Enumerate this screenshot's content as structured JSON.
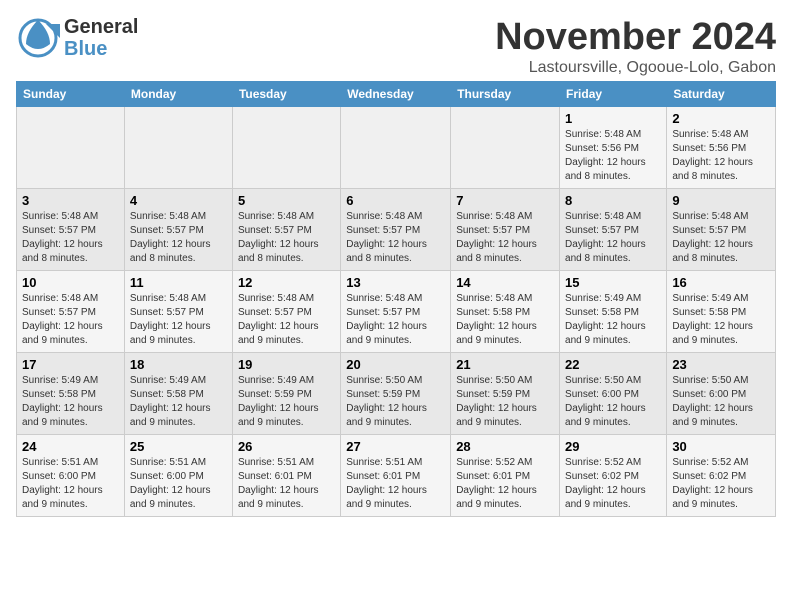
{
  "header": {
    "logo_line1": "General",
    "logo_line2": "Blue",
    "month": "November 2024",
    "location": "Lastoursville, Ogooue-Lolo, Gabon"
  },
  "columns": [
    "Sunday",
    "Monday",
    "Tuesday",
    "Wednesday",
    "Thursday",
    "Friday",
    "Saturday"
  ],
  "weeks": [
    [
      {
        "num": "",
        "detail": ""
      },
      {
        "num": "",
        "detail": ""
      },
      {
        "num": "",
        "detail": ""
      },
      {
        "num": "",
        "detail": ""
      },
      {
        "num": "",
        "detail": ""
      },
      {
        "num": "1",
        "detail": "Sunrise: 5:48 AM\nSunset: 5:56 PM\nDaylight: 12 hours and 8 minutes."
      },
      {
        "num": "2",
        "detail": "Sunrise: 5:48 AM\nSunset: 5:56 PM\nDaylight: 12 hours and 8 minutes."
      }
    ],
    [
      {
        "num": "3",
        "detail": "Sunrise: 5:48 AM\nSunset: 5:57 PM\nDaylight: 12 hours and 8 minutes."
      },
      {
        "num": "4",
        "detail": "Sunrise: 5:48 AM\nSunset: 5:57 PM\nDaylight: 12 hours and 8 minutes."
      },
      {
        "num": "5",
        "detail": "Sunrise: 5:48 AM\nSunset: 5:57 PM\nDaylight: 12 hours and 8 minutes."
      },
      {
        "num": "6",
        "detail": "Sunrise: 5:48 AM\nSunset: 5:57 PM\nDaylight: 12 hours and 8 minutes."
      },
      {
        "num": "7",
        "detail": "Sunrise: 5:48 AM\nSunset: 5:57 PM\nDaylight: 12 hours and 8 minutes."
      },
      {
        "num": "8",
        "detail": "Sunrise: 5:48 AM\nSunset: 5:57 PM\nDaylight: 12 hours and 8 minutes."
      },
      {
        "num": "9",
        "detail": "Sunrise: 5:48 AM\nSunset: 5:57 PM\nDaylight: 12 hours and 8 minutes."
      }
    ],
    [
      {
        "num": "10",
        "detail": "Sunrise: 5:48 AM\nSunset: 5:57 PM\nDaylight: 12 hours and 9 minutes."
      },
      {
        "num": "11",
        "detail": "Sunrise: 5:48 AM\nSunset: 5:57 PM\nDaylight: 12 hours and 9 minutes."
      },
      {
        "num": "12",
        "detail": "Sunrise: 5:48 AM\nSunset: 5:57 PM\nDaylight: 12 hours and 9 minutes."
      },
      {
        "num": "13",
        "detail": "Sunrise: 5:48 AM\nSunset: 5:57 PM\nDaylight: 12 hours and 9 minutes."
      },
      {
        "num": "14",
        "detail": "Sunrise: 5:48 AM\nSunset: 5:58 PM\nDaylight: 12 hours and 9 minutes."
      },
      {
        "num": "15",
        "detail": "Sunrise: 5:49 AM\nSunset: 5:58 PM\nDaylight: 12 hours and 9 minutes."
      },
      {
        "num": "16",
        "detail": "Sunrise: 5:49 AM\nSunset: 5:58 PM\nDaylight: 12 hours and 9 minutes."
      }
    ],
    [
      {
        "num": "17",
        "detail": "Sunrise: 5:49 AM\nSunset: 5:58 PM\nDaylight: 12 hours and 9 minutes."
      },
      {
        "num": "18",
        "detail": "Sunrise: 5:49 AM\nSunset: 5:58 PM\nDaylight: 12 hours and 9 minutes."
      },
      {
        "num": "19",
        "detail": "Sunrise: 5:49 AM\nSunset: 5:59 PM\nDaylight: 12 hours and 9 minutes."
      },
      {
        "num": "20",
        "detail": "Sunrise: 5:50 AM\nSunset: 5:59 PM\nDaylight: 12 hours and 9 minutes."
      },
      {
        "num": "21",
        "detail": "Sunrise: 5:50 AM\nSunset: 5:59 PM\nDaylight: 12 hours and 9 minutes."
      },
      {
        "num": "22",
        "detail": "Sunrise: 5:50 AM\nSunset: 6:00 PM\nDaylight: 12 hours and 9 minutes."
      },
      {
        "num": "23",
        "detail": "Sunrise: 5:50 AM\nSunset: 6:00 PM\nDaylight: 12 hours and 9 minutes."
      }
    ],
    [
      {
        "num": "24",
        "detail": "Sunrise: 5:51 AM\nSunset: 6:00 PM\nDaylight: 12 hours and 9 minutes."
      },
      {
        "num": "25",
        "detail": "Sunrise: 5:51 AM\nSunset: 6:00 PM\nDaylight: 12 hours and 9 minutes."
      },
      {
        "num": "26",
        "detail": "Sunrise: 5:51 AM\nSunset: 6:01 PM\nDaylight: 12 hours and 9 minutes."
      },
      {
        "num": "27",
        "detail": "Sunrise: 5:51 AM\nSunset: 6:01 PM\nDaylight: 12 hours and 9 minutes."
      },
      {
        "num": "28",
        "detail": "Sunrise: 5:52 AM\nSunset: 6:01 PM\nDaylight: 12 hours and 9 minutes."
      },
      {
        "num": "29",
        "detail": "Sunrise: 5:52 AM\nSunset: 6:02 PM\nDaylight: 12 hours and 9 minutes."
      },
      {
        "num": "30",
        "detail": "Sunrise: 5:52 AM\nSunset: 6:02 PM\nDaylight: 12 hours and 9 minutes."
      }
    ]
  ]
}
